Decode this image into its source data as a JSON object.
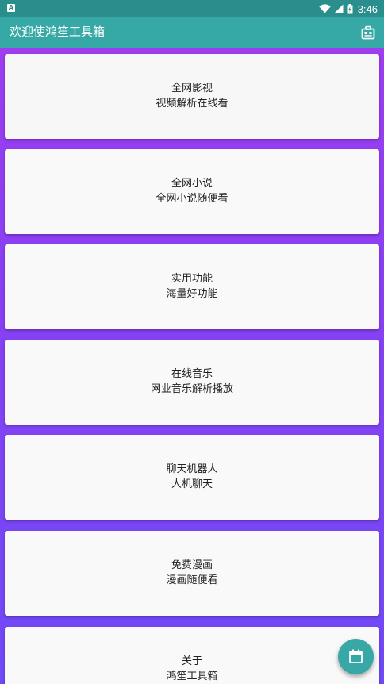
{
  "status_bar": {
    "app_badge": "A",
    "time": "3:46",
    "icons": [
      "wifi-icon",
      "signal-icon",
      "battery-icon"
    ]
  },
  "app_bar": {
    "title": "欢迎使鸿笙工具箱",
    "action_icon": "toolbox-icon"
  },
  "cards": [
    {
      "title": "全网影视",
      "subtitle": "视频解析在线看"
    },
    {
      "title": "全网小说",
      "subtitle": "全网小说随便看"
    },
    {
      "title": "实用功能",
      "subtitle": "海量好功能"
    },
    {
      "title": "在线音乐",
      "subtitle": "网业音乐解析播放"
    },
    {
      "title": "聊天机器人",
      "subtitle": "人机聊天"
    },
    {
      "title": "免费漫画",
      "subtitle": "漫画随便看"
    },
    {
      "title": "关于",
      "subtitle": "鸿笙工具箱"
    }
  ],
  "fab": {
    "icon": "calendar-icon"
  },
  "colors": {
    "primary": "#36a9a6",
    "primary_dark": "#2a8f8c",
    "background_top": "#a13df0",
    "background_bottom": "#6f4af6",
    "card": "#f9f9f9"
  }
}
